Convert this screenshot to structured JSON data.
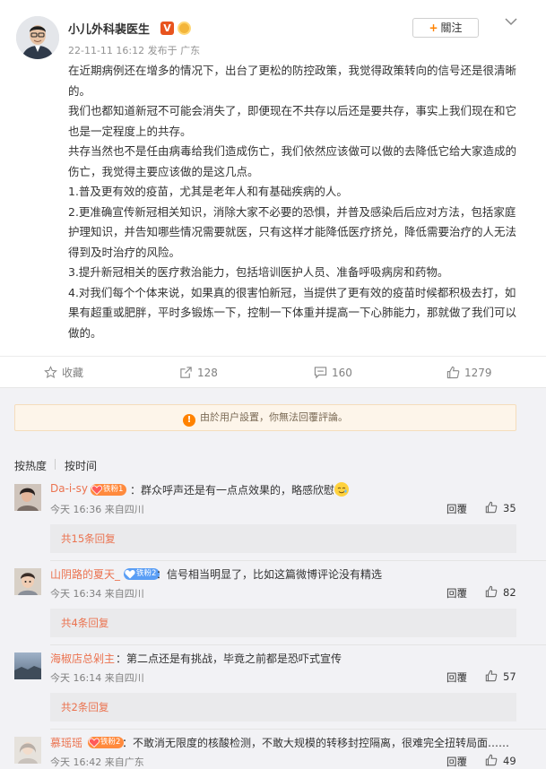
{
  "post": {
    "author_name": "小儿外科裴医生",
    "verified_badge": "V",
    "timestamp": "22-11-11 16:12",
    "source": "发布于 广东",
    "follow_label": "關注",
    "paragraphs": [
      "在近期病例还在增多的情况下，出台了更松的防控政策，我觉得政策转向的信号还是很清晰的。",
      "我们也都知道新冠不可能会消失了，即便现在不共存以后还是要共存，事实上我们现在和它也是一定程度上的共存。",
      "共存当然也不是任由病毒给我们造成伤亡，我们依然应该做可以做的去降低它给大家造成的伤亡，我觉得主要应该做的是这几点。",
      "1.普及更有效的疫苗，尤其是老年人和有基础疾病的人。",
      "2.更准确宣传新冠相关知识，消除大家不必要的恐惧，并普及感染后后应对方法，包括家庭护理知识，并告知哪些情况需要就医，只有这样才能降低医疗挤兑，降低需要治疗的人无法得到及时治疗的风险。",
      "3.提升新冠相关的医疗救治能力，包括培训医护人员、准备呼吸病房和药物。",
      "4.对我们每个个体来说，如果真的很害怕新冠，当提供了更有效的疫苗时候都积极去打，如果有超重或肥胖，平时多锻炼一下，控制一下体重并提高一下心肺能力，那就做了我们可以做的。"
    ]
  },
  "actions": {
    "favorite_label": "收藏",
    "repost_count": "128",
    "comment_count": "160",
    "like_count": "1279"
  },
  "notice": {
    "icon_text": "!",
    "text": "由於用户設置，你無法回覆評論。"
  },
  "sort": {
    "hot_label": "按热度",
    "time_label": "按时间"
  },
  "comments": [
    {
      "name": "Da-i-sy",
      "fan_label": "铁粉1",
      "fan_color": "#ff8a3d",
      "text": "：群众呼声还是有一点点效果的，略感欣慰",
      "has_emoji": true,
      "meta": "今天 16:36 来自四川",
      "reply_label": "回覆",
      "likes": "35",
      "sub_replies": "共15条回复"
    },
    {
      "name": "山阴路的夏天_",
      "fan_label": "铁粉2",
      "fan_color": "#5a9ef5",
      "text": "：信号相当明显了，比如这篇微博评论没有精选",
      "has_emoji": false,
      "meta": "今天 16:34 来自四川",
      "reply_label": "回覆",
      "likes": "82",
      "sub_replies": "共4条回复"
    },
    {
      "name": "海椒店总剁主",
      "fan_label": "",
      "fan_color": "",
      "text": "：第二点还是有挑战，毕竟之前都是恐吓式宣传",
      "has_emoji": false,
      "meta": "今天 16:14 来自四川",
      "reply_label": "回覆",
      "likes": "57",
      "sub_replies": "共2条回复"
    },
    {
      "name": "慕瑶瑶",
      "fan_label": "铁粉2",
      "fan_color": "#ff8a3d",
      "text": "：不敢消无限度的核酸检测，不敢大规模的转移封控隔离，很难完全扭转局面……",
      "has_emoji": false,
      "meta": "今天 16:42 来自广东",
      "reply_label": "回覆",
      "likes": "49",
      "sub_replies": ""
    }
  ],
  "colors": {
    "accent_orange": "#ff8200",
    "username": "#eb7350",
    "verified": "#e8541e",
    "notice_bg": "#fdf5ea"
  },
  "icons": [
    "star-icon",
    "repost-icon",
    "comment-icon",
    "thumbs-up-icon",
    "chevron-down-icon",
    "warning-icon",
    "fan-heart-icon",
    "verified-icon",
    "medal-icon"
  ]
}
